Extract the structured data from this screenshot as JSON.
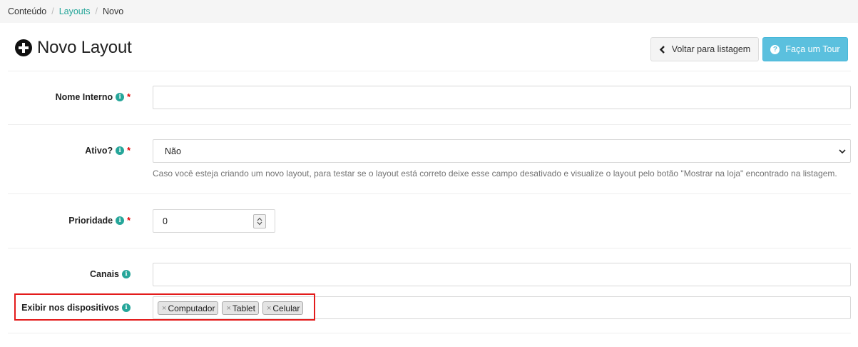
{
  "breadcrumb": {
    "items": [
      "Conteúdo",
      "Layouts",
      "Novo"
    ],
    "separator": "/"
  },
  "page": {
    "title": "Novo Layout",
    "title_icon": "plus-circle-icon"
  },
  "header_buttons": {
    "back_label": "Voltar para listagem",
    "tour_label": "Faça um Tour"
  },
  "form": {
    "nome_interno": {
      "label": "Nome Interno",
      "required_mark": "*",
      "value": ""
    },
    "ativo": {
      "label": "Ativo?",
      "required_mark": "*",
      "value": "Não",
      "help": "Caso você esteja criando um novo layout, para testar se o layout está correto deixe esse campo desativado e visualize o layout pelo botão \"Mostrar na loja\" encontrado na listagem."
    },
    "prioridade": {
      "label": "Prioridade",
      "required_mark": "*",
      "value": "0"
    },
    "canais": {
      "label": "Canais",
      "value": ""
    },
    "dispositivos": {
      "label": "Exibir nos dispositivos",
      "tags": [
        "Computador",
        "Tablet",
        "Celular"
      ],
      "tag_remove_symbol": "×"
    }
  },
  "colors": {
    "accent": "#26a69a",
    "info_button": "#5bc0de",
    "required": "#e00000",
    "highlight": "#e31b1b"
  }
}
